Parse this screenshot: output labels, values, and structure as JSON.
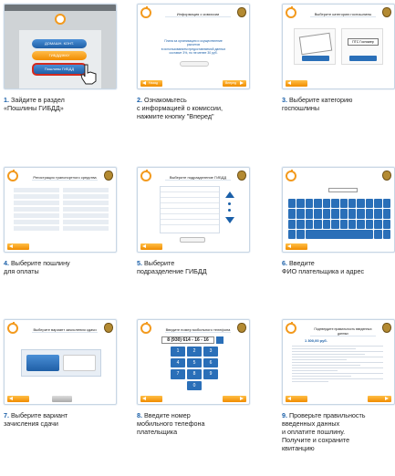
{
  "steps": [
    {
      "number": "1.",
      "lines": [
        "Зайдите в раздел",
        "«Пошлины ГИБДД»"
      ]
    },
    {
      "number": "2.",
      "lines": [
        "Ознакомьтесь",
        "с информацией о комиссии,",
        "нажмите кнопку \"Вперед\""
      ]
    },
    {
      "number": "3.",
      "lines": [
        "Выберите категорию",
        "госпошлины"
      ]
    },
    {
      "number": "4.",
      "lines": [
        "Выберите пошлину",
        "для оплаты"
      ]
    },
    {
      "number": "5.",
      "lines": [
        "Выберите",
        "подразделение ГИБДД"
      ]
    },
    {
      "number": "6.",
      "lines": [
        "Введите",
        "ФИО плательщика и адрес"
      ]
    },
    {
      "number": "7.",
      "lines": [
        "Выберите вариант",
        "зачисления сдачи"
      ]
    },
    {
      "number": "8.",
      "lines": [
        "Введите номер",
        "мобильного телефона",
        "плательщика"
      ]
    },
    {
      "number": "9.",
      "lines": [
        "Проверьте правильность",
        "введенных данных",
        "и оплатите пошлину.",
        "Получите и сохраните",
        "квитанцию"
      ]
    }
  ],
  "screens": {
    "s1": {
      "menu": [
        "ДОМАШН. КОНТ.",
        "ГИБДД/ЖКУ",
        "Пошлины ГИБДД"
      ]
    },
    "s2": {
      "title": "Информация о комиссии",
      "fee_line": "составит 3%, но не менее 30 руб.",
      "back": "Назад",
      "fwd": "Вперед"
    },
    "s3": {
      "title": "Выберите категорию госпошлины",
      "field": "ПТС Госномер"
    },
    "s4": {
      "title": "Регистрация транспортного средства"
    },
    "s5": {
      "title": "Выберите подразделение ГИБДД"
    },
    "s7": {
      "title": "Выберите вариант зачисления сдачи"
    },
    "s8": {
      "title": "Введите номер мобильного телефона",
      "phone": "8 (930) 614 - 16 - 16",
      "keys": [
        "1",
        "2",
        "3",
        "4",
        "5",
        "6",
        "7",
        "8",
        "9",
        "0"
      ]
    },
    "s9": {
      "title": "Подтвердите правильность введенных данных",
      "amount": "1 300,00 руб."
    }
  },
  "colors": {
    "accent": "#f39a1e",
    "blue": "#1a5fa8",
    "step_number": "#1a5fa8"
  }
}
